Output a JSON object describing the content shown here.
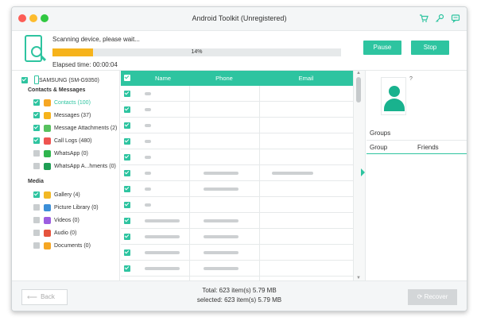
{
  "window": {
    "title": "Android Toolkit (Unregistered)"
  },
  "toolbar_icons": [
    "cart-icon",
    "key-icon",
    "chat-icon"
  ],
  "scan": {
    "status": "Scanning device, please wait...",
    "progress_label": "14%",
    "progress_fraction": 0.14,
    "elapsed": "Elapsed time: 00:00:04",
    "pause_label": "Pause",
    "stop_label": "Stop"
  },
  "sidebar": {
    "device": "SAMSUNG (SM-G9350)",
    "sections": [
      {
        "title": "Contacts & Messages",
        "items": [
          {
            "label": "Contacts (100)",
            "checked": true,
            "icon": "contacts-icon",
            "color": "#f6a623",
            "active": true
          },
          {
            "label": "Messages (37)",
            "checked": true,
            "icon": "messages-icon",
            "color": "#f6b31b",
            "active": false
          },
          {
            "label": "Message Attachments (2)",
            "checked": true,
            "icon": "attachment-icon",
            "color": "#57c15e",
            "active": false
          },
          {
            "label": "Call Logs (480)",
            "checked": true,
            "icon": "call-log-icon",
            "color": "#ef5350",
            "active": false
          },
          {
            "label": "WhatsApp (0)",
            "checked": false,
            "icon": "whatsapp-icon",
            "color": "#2fb54d",
            "active": false
          },
          {
            "label": "WhatsApp A...hments (0)",
            "checked": false,
            "icon": "whatsapp-attachment-icon",
            "color": "#1f9e54",
            "active": false
          }
        ]
      },
      {
        "title": "Media",
        "items": [
          {
            "label": "Gallery (4)",
            "checked": true,
            "icon": "gallery-icon",
            "color": "#f2b824",
            "active": false
          },
          {
            "label": "Picture Library (0)",
            "checked": false,
            "icon": "picture-library-icon",
            "color": "#3c8fd8",
            "active": false
          },
          {
            "label": "Videos (0)",
            "checked": false,
            "icon": "video-icon",
            "color": "#9c5de0",
            "active": false
          },
          {
            "label": "Audio (0)",
            "checked": false,
            "icon": "audio-icon",
            "color": "#e5533d",
            "active": false
          },
          {
            "label": "Documents (0)",
            "checked": false,
            "icon": "documents-icon",
            "color": "#f5a623",
            "active": false
          }
        ]
      }
    ]
  },
  "table": {
    "columns": [
      "Name",
      "Phone",
      "Email"
    ],
    "rows": [
      {
        "name": "~",
        "phone": "",
        "email": ""
      },
      {
        "name": "~",
        "phone": "",
        "email": ""
      },
      {
        "name": "~",
        "phone": "",
        "email": ""
      },
      {
        "name": "~",
        "phone": "",
        "email": ""
      },
      {
        "name": "~",
        "phone": "",
        "email": ""
      },
      {
        "name": "~",
        "phone": "~",
        "email": "~"
      },
      {
        "name": "~",
        "phone": "~",
        "email": ""
      },
      {
        "name": "~",
        "phone": "",
        "email": ""
      },
      {
        "name": "~",
        "phone": "~",
        "email": ""
      },
      {
        "name": "~",
        "phone": "~",
        "email": ""
      },
      {
        "name": "~",
        "phone": "~",
        "email": ""
      },
      {
        "name": "~",
        "phone": "~",
        "email": ""
      },
      {
        "name": "~",
        "phone": "~",
        "email": ""
      }
    ]
  },
  "detail": {
    "avatar_mark": "?",
    "groups_title": "Groups",
    "group_col": "Group",
    "friends_col": "Friends"
  },
  "footer": {
    "back_label": "Back",
    "total": "Total: 623 item(s) 5.79 MB",
    "selected": "selected: 623 item(s) 5.79 MB",
    "recover_label": "Recover"
  },
  "colors": {
    "accent": "#2ec4a0",
    "progress": "#f6b31b",
    "disabled": "#d3d6d8"
  }
}
